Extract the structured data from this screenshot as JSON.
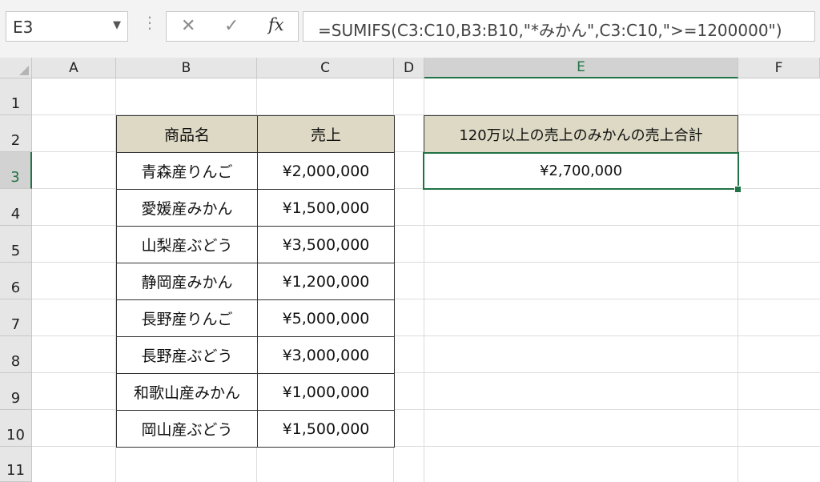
{
  "name_box": "E3",
  "formula": "=SUMIFS(C3:C10,B3:B10,\"*みかん\",C3:C10,\">=1200000\")",
  "columns": [
    "A",
    "B",
    "C",
    "D",
    "E",
    "F"
  ],
  "rows": [
    "1",
    "2",
    "3",
    "4",
    "5",
    "6",
    "7",
    "8",
    "9",
    "10",
    "11"
  ],
  "table": {
    "headers": [
      "商品名",
      "売上"
    ],
    "rows": [
      [
        "青森産りんご",
        "¥2,000,000"
      ],
      [
        "愛媛産みかん",
        "¥1,500,000"
      ],
      [
        "山梨産ぶどう",
        "¥3,500,000"
      ],
      [
        "静岡産みかん",
        "¥1,200,000"
      ],
      [
        "長野産りんご",
        "¥5,000,000"
      ],
      [
        "長野産ぶどう",
        "¥3,000,000"
      ],
      [
        "和歌山産みかん",
        "¥1,000,000"
      ],
      [
        "岡山産ぶどう",
        "¥1,500,000"
      ]
    ]
  },
  "result": {
    "header": "120万以上の売上のみかんの売上合計",
    "value": "¥2,700,000"
  },
  "accent": "#217346",
  "header_fill": "#ddd9c4"
}
